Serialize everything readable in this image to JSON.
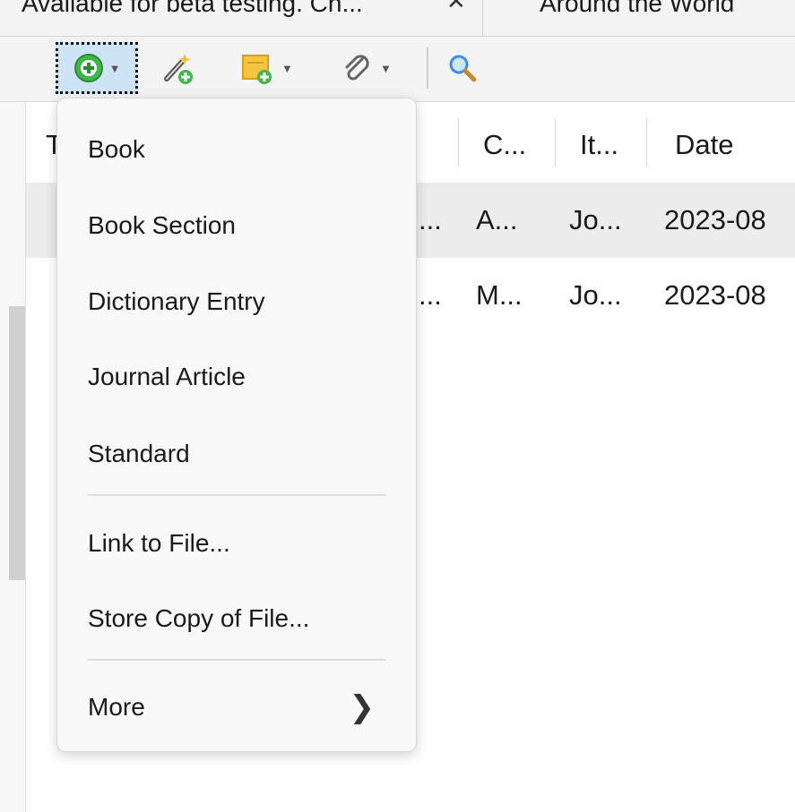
{
  "tabs": [
    {
      "label": "Available for beta testing. Ch..."
    },
    {
      "label": "Around the World"
    }
  ],
  "toolbar": {
    "new_item_icon": "plus-circle-icon",
    "add_by_identifier_icon": "magic-wand-icon",
    "new_note_icon": "note-icon",
    "add_attachment_icon": "paperclip-icon",
    "search_icon": "search-icon"
  },
  "table": {
    "columns": [
      {
        "label": "T"
      },
      {
        "label": "C..."
      },
      {
        "label": "It..."
      },
      {
        "label": "Date"
      }
    ],
    "rows": [
      {
        "title": "...",
        "creator": "A...",
        "item_type": "Jo...",
        "date": "2023-08"
      },
      {
        "title": "...",
        "creator": "M...",
        "item_type": "Jo...",
        "date": "2023-08"
      }
    ]
  },
  "menu": {
    "items": [
      {
        "label": "Book"
      },
      {
        "label": "Book Section"
      },
      {
        "label": "Dictionary Entry"
      },
      {
        "label": "Journal Article"
      },
      {
        "label": "Standard"
      },
      {
        "label": "Link to File..."
      },
      {
        "label": "Store Copy of File..."
      },
      {
        "label": "More",
        "submenu_icon": "chevron-right-icon"
      }
    ]
  },
  "colors": {
    "accent_selected_button": "#cfe3f7",
    "icon_green": "#3cb04a",
    "icon_yellow": "#f0c23a",
    "search_blue": "#3e8fe0"
  }
}
